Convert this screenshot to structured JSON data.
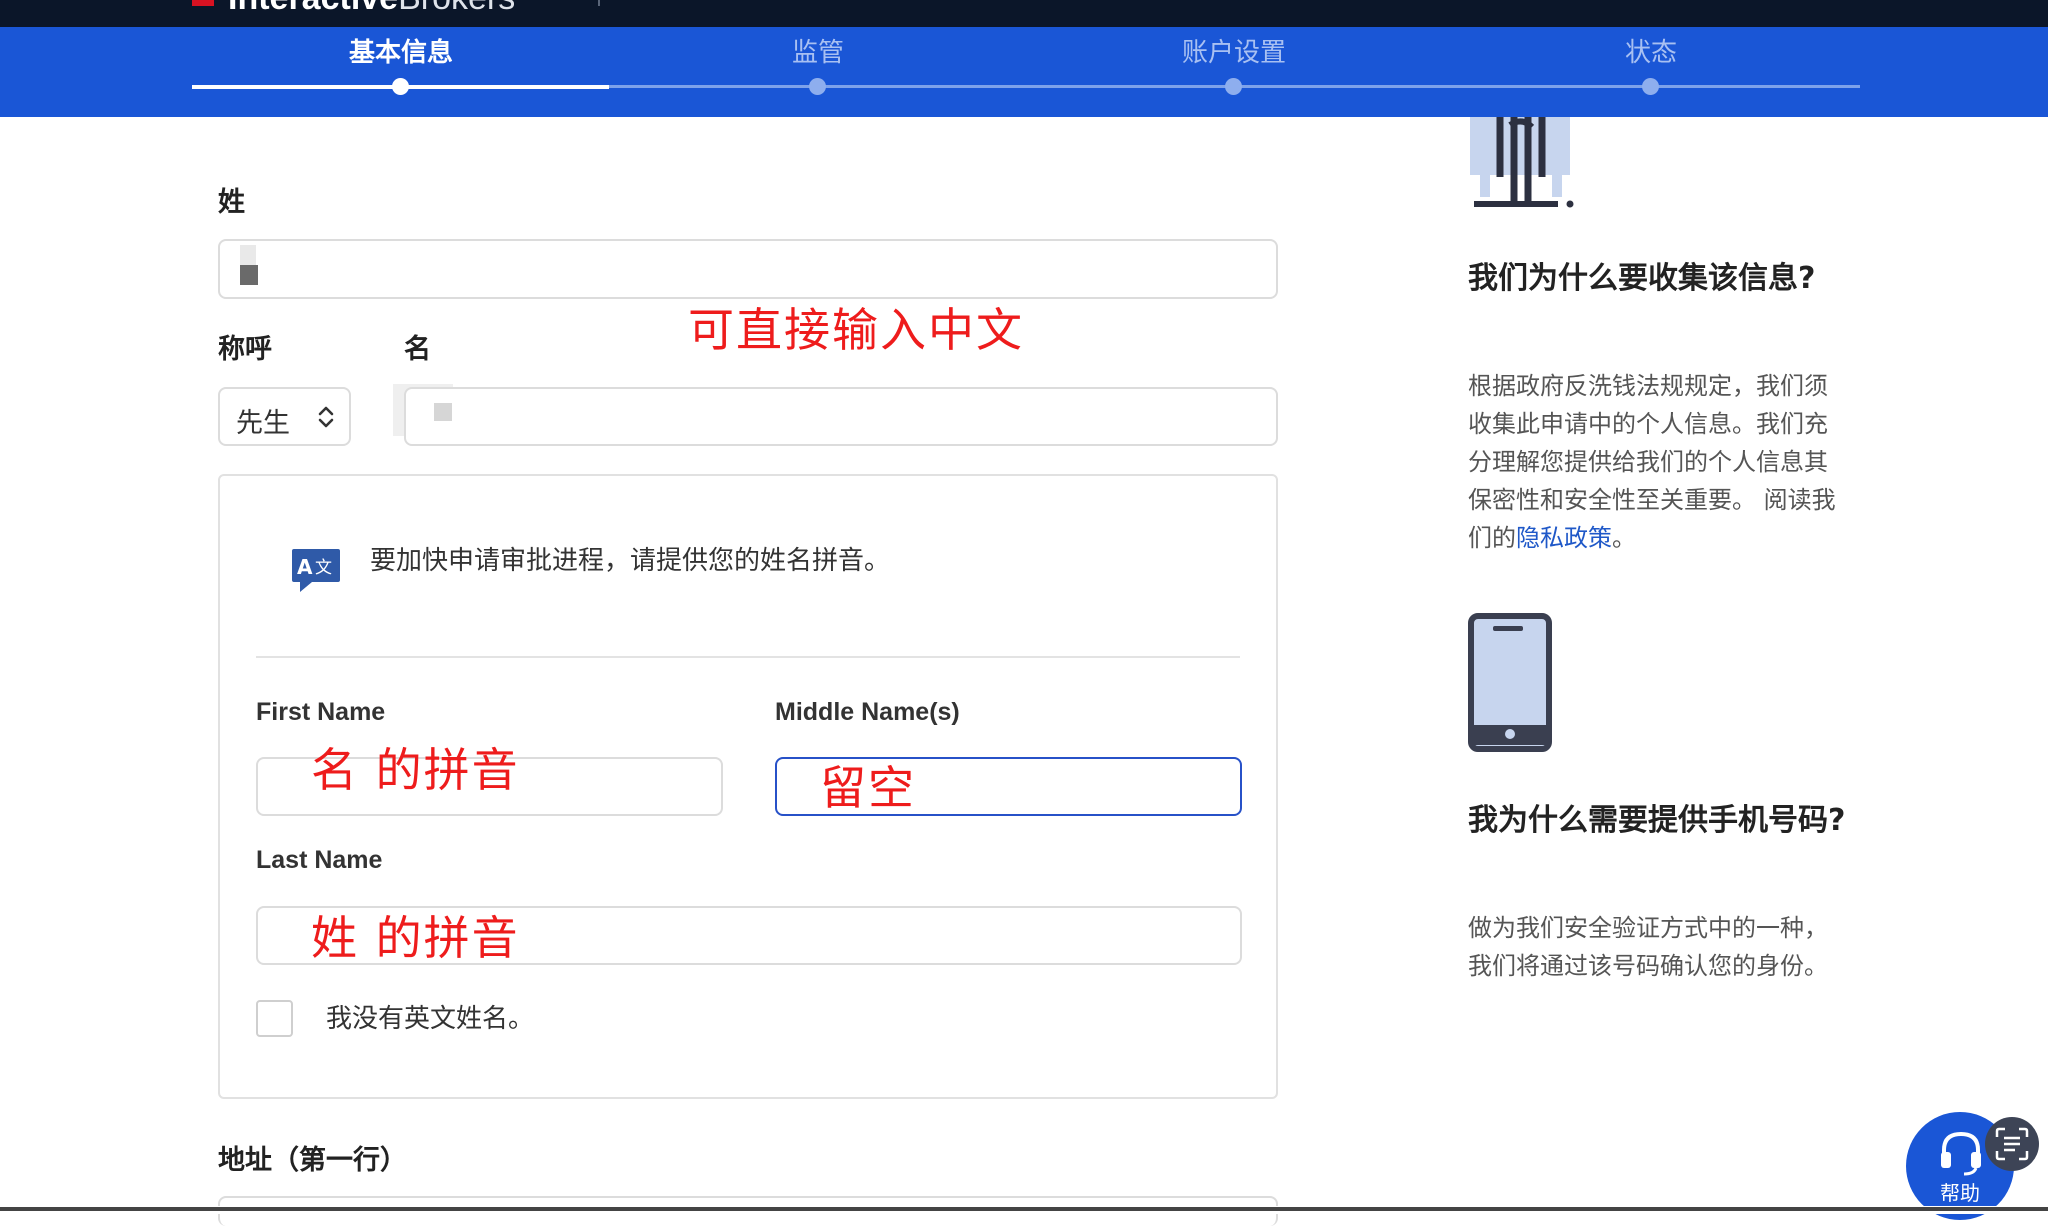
{
  "brand": {
    "bold": "Interactive",
    "light": "Brokers"
  },
  "steps": [
    {
      "label": "基本信息",
      "active": true
    },
    {
      "label": "监管",
      "active": false
    },
    {
      "label": "账户设置",
      "active": false
    },
    {
      "label": "状态",
      "active": false
    }
  ],
  "form": {
    "surname_label": "姓",
    "salutation_label": "称呼",
    "given_name_label": "名",
    "salutation_value": "先生",
    "pinyin_notice": "要加快申请审批进程，请提供您的姓名拼音。",
    "first_name_label": "First Name",
    "middle_name_label": "Middle Name(s)",
    "last_name_label": "Last Name",
    "no_english_name": "我没有英文姓名。",
    "address_label": "地址（第一行）"
  },
  "annotations": {
    "chinese_input": "可直接输入中文",
    "first_name_hint": "名 的拼音",
    "middle_name_hint": "留空",
    "last_name_hint": "姓 的拼音"
  },
  "sidebar": {
    "why_collect_title": "我们为什么要收集该信息?",
    "why_collect_text": "根据政府反洗钱法规规定，我们须收集此申请中的个人信息。我们充分理解您提供给我们的个人信息其保密性和安全性至关重要。 阅读我们的",
    "privacy_link": "隐私政策",
    "why_collect_tail": "。",
    "why_phone_title": "我为什么需要提供手机号码?",
    "why_phone_text": "做为我们安全验证方式中的一种，我们将通过该号码确认您的身份。"
  },
  "help": {
    "label": "帮助"
  },
  "colors": {
    "brand_blue": "#1a56d6",
    "annotation_red": "#ee1c1c",
    "link_blue": "#1f58c8"
  }
}
